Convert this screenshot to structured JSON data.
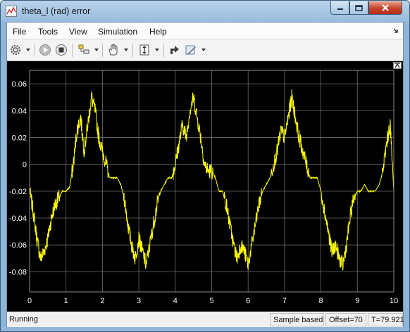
{
  "window": {
    "title": "theta_l (rad) error"
  },
  "menu": {
    "items": [
      "File",
      "Tools",
      "View",
      "Simulation",
      "Help"
    ]
  },
  "toolbar": {
    "icons": [
      "gear-icon",
      "run-icon",
      "stop-icon",
      "highlight-block-icon",
      "pan-icon",
      "axis-scale-icon",
      "restore-icon",
      "style-icon"
    ]
  },
  "plot": {
    "background": "#000000",
    "trace_color": "#ffff00",
    "grid_color": "#6e6e6e",
    "x_ticks": [
      "0",
      "1",
      "2",
      "3",
      "4",
      "5",
      "6",
      "7",
      "8",
      "9",
      "10"
    ],
    "y_ticks": [
      "0.06",
      "0.04",
      "0.02",
      "0",
      "-0.02",
      "-0.04",
      "-0.06",
      "-0.08"
    ],
    "xlim": [
      0,
      10
    ],
    "ylim": [
      -0.095,
      0.07
    ]
  },
  "chart_data": {
    "type": "line",
    "xlim": [
      0,
      10
    ],
    "ylim": [
      -0.095,
      0.07
    ],
    "grid": true,
    "series": [
      {
        "x": [
          0,
          0.1,
          0.2,
          0.3,
          0.4,
          0.5,
          0.6,
          0.7,
          0.8,
          0.9,
          1.0,
          1.1,
          1.2,
          1.3,
          1.4,
          1.5,
          1.6,
          1.7,
          1.8,
          1.9,
          2.0,
          2.1,
          2.2,
          2.3,
          2.4,
          2.5,
          2.6,
          2.7,
          2.8,
          2.9,
          3.0,
          3.1,
          3.2,
          3.3,
          3.4,
          3.5,
          3.6,
          3.7,
          3.8,
          3.9,
          4.0,
          4.1,
          4.2,
          4.3,
          4.4,
          4.5,
          4.6,
          4.7,
          4.8,
          4.9,
          5.0,
          5.1,
          5.2,
          5.3,
          5.4,
          5.5,
          5.6,
          5.7,
          5.8,
          5.9,
          6.0,
          6.1,
          6.2,
          6.3,
          6.4,
          6.5,
          6.6,
          6.7,
          6.8,
          6.9,
          7.0,
          7.1,
          7.2,
          7.3,
          7.4,
          7.5,
          7.6,
          7.7,
          7.8,
          7.9,
          8.0,
          8.1,
          8.2,
          8.3,
          8.4,
          8.5,
          8.6,
          8.7,
          8.8,
          8.9,
          9.0,
          9.1,
          9.2,
          9.3,
          9.4,
          9.5,
          9.6,
          9.7,
          9.8,
          9.9,
          10.0
        ],
        "y": [
          -0.02,
          -0.035,
          -0.055,
          -0.07,
          -0.065,
          -0.055,
          -0.04,
          -0.03,
          -0.025,
          -0.02,
          -0.02,
          -0.017,
          0.0,
          0.025,
          0.035,
          0.01,
          0.03,
          0.05,
          0.04,
          0.02,
          0.01,
          0.0,
          -0.01,
          -0.01,
          -0.01,
          -0.015,
          -0.025,
          -0.045,
          -0.06,
          -0.07,
          -0.055,
          -0.065,
          -0.075,
          -0.06,
          -0.045,
          -0.03,
          -0.02,
          -0.015,
          -0.01,
          -0.01,
          0.0,
          0.015,
          0.03,
          0.02,
          0.04,
          0.05,
          0.035,
          0.02,
          0.0,
          -0.005,
          -0.005,
          -0.01,
          -0.02,
          -0.02,
          -0.03,
          -0.045,
          -0.06,
          -0.07,
          -0.06,
          -0.065,
          -0.075,
          -0.06,
          -0.045,
          -0.03,
          -0.02,
          -0.015,
          -0.01,
          0.0,
          0.01,
          0.025,
          0.02,
          0.035,
          0.05,
          0.035,
          0.02,
          0.01,
          0.0,
          -0.01,
          -0.01,
          -0.01,
          -0.02,
          -0.035,
          -0.05,
          -0.065,
          -0.06,
          -0.07,
          -0.075,
          -0.06,
          -0.04,
          -0.025,
          -0.02,
          -0.02,
          -0.015,
          -0.02,
          -0.02,
          -0.02,
          -0.015,
          -0.005,
          0.015,
          0.03,
          -0.02
        ]
      }
    ]
  },
  "status": {
    "state": "Running",
    "mode": "Sample based",
    "offset": "Offset=70",
    "time": "T=79.921"
  }
}
